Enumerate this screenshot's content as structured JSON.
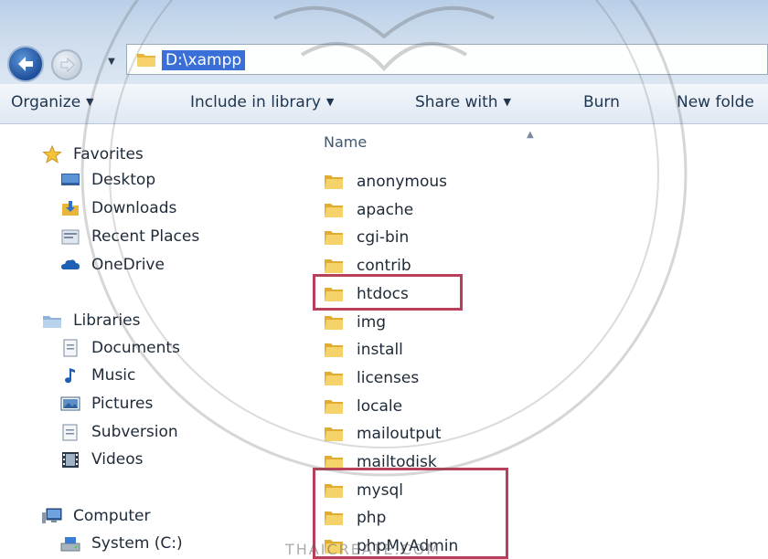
{
  "address_bar": {
    "path": "D:\\xampp"
  },
  "command_bar": {
    "organize": "Organize",
    "include_in_library": "Include in library",
    "share_with": "Share with",
    "burn": "Burn",
    "new_folder": "New folde"
  },
  "nav_pane": {
    "favorites": {
      "label": "Favorites",
      "items": [
        {
          "label": "Desktop",
          "icon": "desktop-icon"
        },
        {
          "label": "Downloads",
          "icon": "downloads-icon"
        },
        {
          "label": "Recent Places",
          "icon": "recent-places-icon"
        },
        {
          "label": "OneDrive",
          "icon": "onedrive-icon"
        }
      ]
    },
    "libraries": {
      "label": "Libraries",
      "items": [
        {
          "label": "Documents",
          "icon": "documents-icon"
        },
        {
          "label": "Music",
          "icon": "music-icon"
        },
        {
          "label": "Pictures",
          "icon": "pictures-icon"
        },
        {
          "label": "Subversion",
          "icon": "subversion-icon"
        },
        {
          "label": "Videos",
          "icon": "videos-icon"
        }
      ]
    },
    "computer": {
      "label": "Computer",
      "items": [
        {
          "label": "System  (C:)",
          "icon": "drive-icon"
        }
      ]
    }
  },
  "file_list": {
    "column_name": "Name",
    "folders": [
      "anonymous",
      "apache",
      "cgi-bin",
      "contrib",
      "htdocs",
      "img",
      "install",
      "licenses",
      "locale",
      "mailoutput",
      "mailtodisk",
      "mysql",
      "php",
      "phpMyAdmin"
    ]
  },
  "colors": {
    "highlight_box": "#b8405a",
    "address_selection": "#3a6fd8",
    "folder_yellow": "#f2c64c"
  },
  "watermark": {
    "caption": "THAICREATE.COM"
  }
}
